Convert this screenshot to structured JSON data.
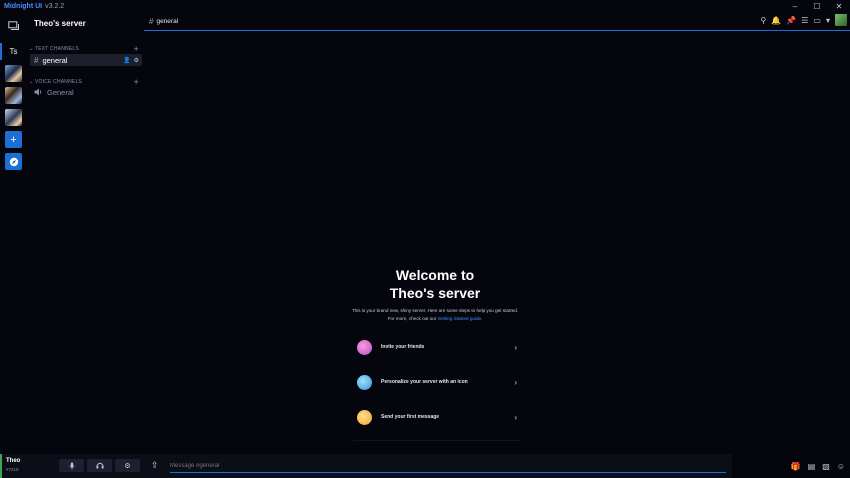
{
  "titlebar": {
    "app_name": "Midnight UI",
    "version": "v3.2.2",
    "minimize": "–",
    "maximize": "☐",
    "close": "✕"
  },
  "rail": {
    "dm_icon": "chat-bubble-icon",
    "server_abbrev": "Ts",
    "add_label": "+",
    "explore_icon": "compass-icon"
  },
  "server": {
    "name": "Theo's server"
  },
  "categories": {
    "text": {
      "label": "TEXT CHANNELS",
      "add": "+"
    },
    "voice": {
      "label": "VOICE CHANNELS",
      "add": "+"
    }
  },
  "channels": {
    "text": [
      {
        "name": "general"
      }
    ],
    "voice": [
      {
        "name": "General"
      }
    ]
  },
  "header": {
    "channel_name": "general"
  },
  "welcome": {
    "title_line1": "Welcome to",
    "title_line2": "Theo's server",
    "desc_line1": "This is your brand new, shiny server. Here are some steps to help you get started.",
    "desc_line2_prefix": "For more, check out our ",
    "desc_link": "Getting Started guide",
    "desc_line2_suffix": "."
  },
  "actions": [
    {
      "label": "Invite your friends"
    },
    {
      "label": "Personalize your server with an icon"
    },
    {
      "label": "Send your first message"
    }
  ],
  "user": {
    "name": "Theo",
    "tag": "#7219"
  },
  "composer": {
    "placeholder": "Message #general"
  },
  "colors": {
    "accent": "#1b6fd6",
    "online": "#3ba55c",
    "background": "#05060d"
  }
}
